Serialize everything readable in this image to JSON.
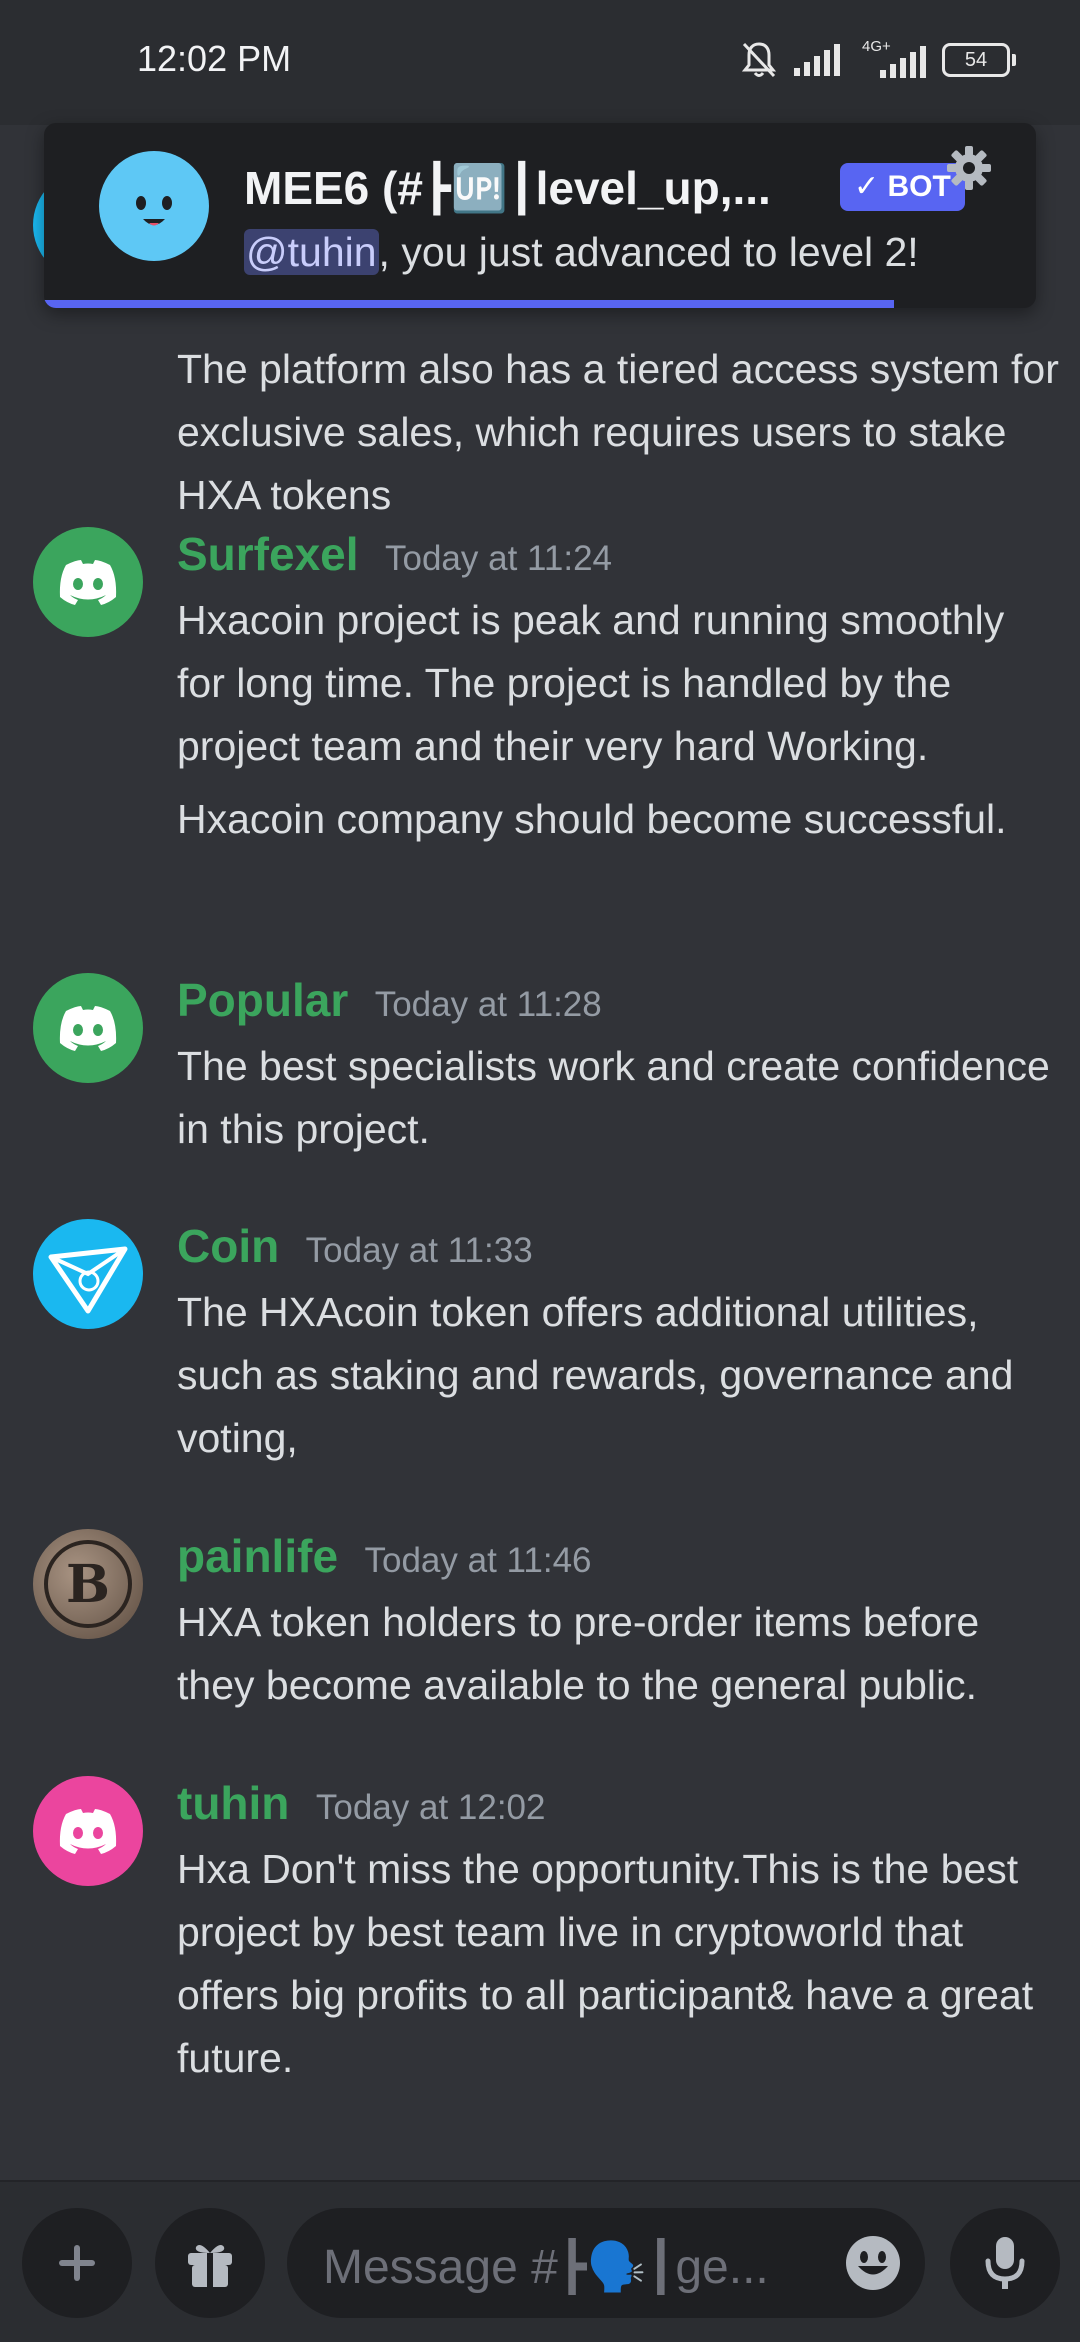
{
  "status_bar": {
    "time": "12:02 PM",
    "network_label": "4G+",
    "battery": "54"
  },
  "notification": {
    "title": "MEE6 (#┣🆙┃level_up,...",
    "badge": "BOT",
    "mention": "@tuhin",
    "text": ", you just advanced to level 2!"
  },
  "messages": [
    {
      "partial": true,
      "lines": [
        "The platform also has a tiered access system for exclusive sales, which requires users to stake HXA tokens"
      ]
    },
    {
      "username": "Surfexel",
      "timestamp": "Today at 11:24",
      "avatar_icon": "discord-logo-icon",
      "avatar_color": "#3ba55d",
      "lines": [
        "Hxacoin project is peak and running smoothly for long time. The project is handled by the project team and their very hard Working.",
        "Hxacoin company should become successful."
      ]
    },
    {
      "username": "Popular",
      "timestamp": "Today at 11:28",
      "avatar_icon": "discord-logo-icon",
      "avatar_color": "#3ba55d",
      "lines": [
        "The best specialists work and create confidence in this project."
      ]
    },
    {
      "username": "Coin",
      "timestamp": "Today at 11:33",
      "avatar_icon": "coin-logo-icon",
      "avatar_color": "#1ab8f0",
      "lines": [
        "The HXAcoin token offers additional utilities, such as staking and rewards, governance and voting,"
      ]
    },
    {
      "username": "painlife",
      "timestamp": "Today at 11:46",
      "avatar_icon": "bitcoin-coin-icon",
      "avatar_color": "#6b5a4e",
      "lines": [
        "HXA token holders to pre-order items before they become available to the general public."
      ]
    },
    {
      "username": "tuhin",
      "timestamp": "Today at 12:02",
      "avatar_icon": "discord-logo-icon",
      "avatar_color": "#eb459e",
      "lines": [
        "Hxa Don't miss the opportunity.This is the best project by best team live in cryptoworld that offers big profits to all participant& have a great future."
      ]
    }
  ],
  "composer": {
    "placeholder": "Message #┣🗣️┃ge..."
  },
  "colors": {
    "background": "#313338",
    "username_green": "#3ba55d",
    "blurple": "#5865f2"
  }
}
